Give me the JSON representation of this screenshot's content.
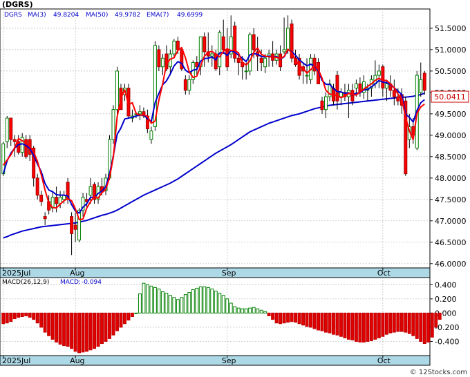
{
  "chart_data": [
    {
      "type": "candlestick",
      "title": "(DGRS)",
      "legend": [
        {
          "name": "DGRS",
          "value": "",
          "color": "#0000cc"
        },
        {
          "name": "MA(3)",
          "value": "49.8204",
          "color": "#0000cc"
        },
        {
          "name": "MA(50)",
          "value": "49.9782",
          "color": "#0000cc"
        },
        {
          "name": "EMA(7)",
          "value": "49.6999",
          "color": "#0000cc"
        }
      ],
      "last_price": "50.0411",
      "x_labels": [
        {
          "label": "2025Jul",
          "index": 0
        },
        {
          "label": "Aug",
          "index": 19
        },
        {
          "label": "Sep",
          "index": 59
        },
        {
          "label": "Oct",
          "index": 100
        }
      ],
      "y_ticks": [
        46.0,
        46.5,
        47.0,
        47.5,
        48.0,
        48.5,
        49.0,
        49.5,
        50.0,
        50.5,
        51.0,
        51.5
      ],
      "ylim": [
        45.9,
        51.95
      ],
      "grid": true,
      "colors": {
        "up": "#008000",
        "down": "#ff0000",
        "ma_short": "#ff0000",
        "ma_long": "#0000cc",
        "price_box": "#cc0000"
      },
      "candles": [
        [
          48.1,
          48.85,
          48.05,
          48.8
        ],
        [
          48.85,
          49.45,
          48.7,
          49.4
        ],
        [
          49.4,
          49.4,
          48.75,
          48.9
        ],
        [
          48.9,
          49.0,
          48.5,
          48.85
        ],
        [
          48.85,
          49.0,
          48.55,
          48.6
        ],
        [
          48.6,
          49.05,
          48.5,
          48.95
        ],
        [
          48.9,
          49.0,
          48.45,
          48.5
        ],
        [
          48.9,
          49.0,
          48.4,
          48.55
        ],
        [
          48.7,
          48.75,
          47.8,
          48.0
        ],
        [
          48.0,
          48.1,
          47.5,
          47.6
        ],
        [
          47.6,
          47.7,
          47.35,
          47.45
        ],
        [
          47.1,
          47.2,
          46.9,
          47.05
        ],
        [
          47.45,
          47.6,
          47.15,
          47.25
        ],
        [
          47.3,
          47.7,
          47.2,
          47.55
        ],
        [
          47.55,
          47.8,
          47.2,
          47.4
        ],
        [
          47.4,
          47.7,
          47.3,
          47.55
        ],
        [
          47.5,
          47.7,
          47.4,
          47.6
        ],
        [
          47.9,
          48.0,
          47.4,
          47.5
        ],
        [
          47.1,
          47.2,
          46.2,
          46.7
        ],
        [
          46.9,
          47.2,
          46.5,
          46.8
        ],
        [
          46.55,
          47.3,
          46.5,
          47.25
        ],
        [
          47.25,
          47.65,
          47.1,
          47.55
        ],
        [
          47.5,
          47.65,
          47.3,
          47.45
        ],
        [
          47.6,
          48.0,
          47.4,
          47.8
        ],
        [
          47.85,
          47.9,
          47.4,
          47.5
        ],
        [
          47.5,
          47.9,
          47.4,
          47.8
        ],
        [
          47.8,
          48.0,
          47.6,
          47.7
        ],
        [
          47.7,
          48.1,
          47.6,
          48.0
        ],
        [
          48.0,
          49.0,
          47.95,
          48.9
        ],
        [
          48.9,
          49.7,
          48.8,
          49.6
        ],
        [
          49.6,
          50.6,
          49.5,
          50.5
        ],
        [
          50.1,
          50.2,
          49.6,
          49.6
        ],
        [
          49.95,
          50.2,
          49.8,
          50.1
        ],
        [
          50.1,
          50.2,
          49.4,
          49.45
        ],
        [
          49.4,
          49.6,
          49.3,
          49.45
        ],
        [
          49.5,
          49.55,
          49.4,
          49.5
        ],
        [
          49.5,
          49.7,
          49.35,
          49.55
        ],
        [
          49.55,
          49.65,
          49.4,
          49.45
        ],
        [
          49.45,
          49.6,
          49.05,
          49.15
        ],
        [
          48.9,
          49.2,
          48.8,
          49.1
        ],
        [
          49.2,
          51.2,
          49.1,
          51.1
        ],
        [
          51.0,
          51.1,
          50.5,
          50.6
        ],
        [
          50.6,
          50.9,
          50.4,
          50.8
        ],
        [
          50.9,
          51.1,
          50.5,
          50.55
        ],
        [
          50.6,
          51.0,
          50.4,
          50.9
        ],
        [
          50.9,
          51.25,
          50.8,
          51.2
        ],
        [
          51.2,
          51.3,
          50.9,
          51.0
        ],
        [
          51.0,
          51.05,
          50.5,
          50.55
        ],
        [
          50.3,
          50.4,
          49.95,
          50.05
        ],
        [
          50.05,
          50.4,
          49.95,
          50.3
        ],
        [
          50.3,
          50.75,
          50.2,
          50.7
        ],
        [
          50.7,
          50.85,
          50.4,
          50.6
        ],
        [
          50.6,
          51.3,
          50.4,
          51.3
        ],
        [
          51.3,
          51.4,
          50.6,
          50.95
        ],
        [
          50.95,
          51.4,
          50.7,
          50.85
        ],
        [
          50.85,
          51.1,
          50.6,
          50.9
        ],
        [
          50.9,
          51.0,
          50.5,
          50.55
        ],
        [
          50.6,
          51.45,
          50.4,
          51.4
        ],
        [
          51.3,
          51.7,
          50.9,
          51.0
        ],
        [
          51.0,
          51.5,
          50.5,
          50.6
        ],
        [
          50.9,
          51.8,
          50.8,
          51.3
        ],
        [
          51.55,
          51.65,
          50.7,
          50.8
        ],
        [
          50.8,
          50.95,
          50.4,
          50.7
        ],
        [
          50.7,
          50.85,
          50.3,
          50.6
        ],
        [
          50.5,
          50.7,
          50.3,
          50.5
        ],
        [
          50.5,
          51.4,
          50.4,
          51.35
        ],
        [
          51.35,
          51.5,
          50.8,
          51.0
        ],
        [
          50.95,
          51.3,
          50.5,
          50.85
        ],
        [
          50.8,
          51.0,
          50.5,
          50.7
        ],
        [
          50.6,
          50.9,
          50.45,
          50.8
        ],
        [
          50.85,
          51.0,
          50.6,
          50.9
        ],
        [
          50.9,
          51.2,
          50.6,
          50.75
        ],
        [
          50.75,
          51.0,
          50.65,
          50.9
        ],
        [
          50.9,
          51.1,
          50.5,
          50.6
        ],
        [
          50.95,
          51.75,
          50.9,
          51.0
        ],
        [
          51.0,
          51.8,
          50.9,
          51.5
        ],
        [
          51.6,
          51.7,
          50.7,
          50.8
        ],
        [
          50.8,
          51.0,
          50.6,
          50.65
        ],
        [
          50.8,
          50.9,
          50.3,
          50.4
        ],
        [
          50.6,
          50.7,
          50.2,
          50.5
        ],
        [
          50.4,
          50.8,
          50.2,
          50.4
        ],
        [
          50.3,
          50.9,
          50.2,
          50.8
        ],
        [
          50.8,
          50.9,
          50.4,
          50.5
        ],
        [
          50.7,
          50.8,
          50.2,
          50.2
        ],
        [
          49.8,
          49.9,
          49.5,
          49.6
        ],
        [
          49.6,
          50.0,
          49.4,
          49.9
        ],
        [
          49.9,
          50.3,
          49.8,
          50.2
        ],
        [
          50.1,
          50.2,
          49.7,
          49.8
        ],
        [
          50.4,
          50.5,
          49.6,
          49.8
        ],
        [
          49.9,
          50.1,
          49.7,
          50.0
        ],
        [
          50.0,
          50.2,
          49.8,
          49.9
        ],
        [
          49.9,
          50.2,
          49.4,
          50.05
        ],
        [
          50.05,
          50.2,
          49.7,
          49.8
        ],
        [
          50.1,
          50.3,
          49.9,
          50.2
        ],
        [
          50.2,
          50.35,
          49.9,
          50.0
        ],
        [
          50.0,
          50.4,
          49.85,
          50.25
        ],
        [
          50.05,
          50.2,
          49.8,
          50.1
        ],
        [
          50.1,
          50.4,
          49.9,
          50.3
        ],
        [
          50.2,
          50.75,
          50.1,
          50.4
        ],
        [
          50.4,
          50.65,
          50.1,
          50.5
        ],
        [
          50.6,
          50.65,
          49.9,
          50.1
        ],
        [
          50.1,
          50.3,
          49.8,
          50.2
        ],
        [
          50.2,
          50.4,
          49.9,
          50.05
        ],
        [
          50.05,
          50.3,
          49.7,
          49.9
        ],
        [
          49.9,
          50.1,
          49.7,
          49.8
        ],
        [
          49.95,
          50.1,
          49.5,
          49.7
        ],
        [
          49.8,
          49.9,
          48.05,
          48.1
        ],
        [
          48.9,
          49.5,
          48.7,
          49.2
        ],
        [
          49.2,
          49.4,
          48.8,
          49.0
        ],
        [
          48.7,
          50.5,
          48.65,
          50.4
        ],
        [
          50.0,
          50.7,
          49.9,
          50.3
        ],
        [
          50.45,
          50.5,
          49.95,
          50.05
        ]
      ],
      "series": [
        {
          "name": "MA(3)",
          "values": [
            48.3,
            48.42,
            48.54,
            48.71,
            48.92,
            48.87,
            48.82,
            48.74,
            48.61,
            48.39,
            48.08,
            47.72,
            47.42,
            47.31,
            47.3,
            47.39,
            47.47,
            47.52,
            47.47,
            47.28,
            47.03,
            47.04,
            47.3,
            47.45,
            47.57,
            47.53,
            47.66,
            47.73,
            48.01,
            48.49,
            49.43,
            49.87,
            50.06,
            49.71,
            49.76,
            49.51,
            49.47,
            49.48,
            49.44,
            49.28,
            49.33,
            49.82,
            50.2,
            50.66,
            50.78,
            50.81,
            50.98,
            51.05,
            50.81,
            50.48,
            50.35,
            50.38,
            50.62,
            50.85,
            50.94,
            50.96,
            50.89,
            50.83,
            50.96,
            51.02,
            50.98,
            50.99,
            50.92,
            50.7,
            50.64,
            50.74,
            50.94,
            51.04,
            50.89,
            50.85,
            50.83,
            50.83,
            50.82,
            50.79,
            50.84,
            51.01,
            50.93,
            50.76,
            50.62,
            50.57,
            50.45,
            50.53,
            50.64,
            50.54,
            50.33,
            50.05,
            49.96,
            49.95,
            49.92,
            49.88,
            49.91,
            49.98,
            49.95,
            49.94,
            50.01,
            50.08,
            50.14,
            50.2,
            50.28,
            50.33,
            50.28,
            50.28,
            50.2,
            50.11,
            49.96,
            49.85,
            49.42,
            49.1,
            48.9,
            49.51,
            49.66,
            49.73
          ]
        },
        {
          "name": "MA(50)",
          "values": [
            46.6,
            46.63,
            46.67,
            46.7,
            46.73,
            46.76,
            46.78,
            46.8,
            46.82,
            46.84,
            46.86,
            46.87,
            46.88,
            46.89,
            46.9,
            46.91,
            46.92,
            46.93,
            46.94,
            46.95,
            46.97,
            46.99,
            47.01,
            47.04,
            47.07,
            47.1,
            47.13,
            47.15,
            47.18,
            47.21,
            47.25,
            47.3,
            47.35,
            47.4,
            47.45,
            47.5,
            47.55,
            47.6,
            47.64,
            47.68,
            47.72,
            47.76,
            47.8,
            47.84,
            47.88,
            47.93,
            47.98,
            48.04,
            48.1,
            48.16,
            48.22,
            48.28,
            48.34,
            48.4,
            48.46,
            48.52,
            48.58,
            48.63,
            48.68,
            48.73,
            48.78,
            48.84,
            48.9,
            48.96,
            49.02,
            49.08,
            49.12,
            49.16,
            49.2,
            49.24,
            49.28,
            49.31,
            49.34,
            49.37,
            49.4,
            49.43,
            49.46,
            49.48,
            49.5,
            49.53,
            49.56,
            49.59,
            49.62,
            49.64,
            49.66,
            49.68,
            49.7,
            49.71,
            49.72,
            49.73,
            49.74,
            49.75,
            49.76,
            49.77,
            49.78,
            49.79,
            49.8,
            49.81,
            49.82,
            49.83,
            49.84,
            49.85,
            49.86,
            49.87,
            49.88,
            49.89,
            49.89,
            49.9,
            49.91,
            49.93,
            49.95,
            49.98
          ]
        },
        {
          "name": "EMA(7)",
          "values": [
            48.1,
            48.4,
            48.58,
            48.7,
            48.78,
            48.8,
            48.76,
            48.69,
            48.53,
            48.33,
            48.15,
            47.87,
            47.72,
            47.68,
            47.61,
            47.6,
            47.6,
            47.58,
            47.38,
            47.23,
            47.18,
            47.32,
            47.4,
            47.55,
            47.55,
            47.64,
            47.69,
            47.8,
            48.1,
            48.52,
            49.02,
            49.17,
            49.38,
            49.4,
            49.42,
            49.45,
            49.47,
            49.47,
            49.39,
            49.32,
            49.76,
            49.98,
            50.18,
            50.27,
            50.43,
            50.62,
            50.72,
            50.68,
            50.52,
            50.46,
            50.52,
            50.54,
            50.73,
            50.79,
            50.8,
            50.83,
            50.76,
            50.92,
            50.94,
            50.86,
            50.98,
            50.94,
            50.87,
            50.8,
            50.72,
            50.88,
            50.91,
            50.89,
            50.84,
            50.83,
            50.85,
            50.83,
            50.84,
            50.78,
            50.83,
            51.0,
            50.95,
            50.87,
            50.76,
            50.69,
            50.62,
            50.66,
            50.62,
            50.51,
            50.28,
            50.19,
            50.19,
            50.09,
            50.02,
            50.01,
            49.98,
            49.99,
            49.94,
            49.98,
            49.99,
            50.06,
            50.07,
            50.13,
            50.2,
            50.28,
            50.24,
            50.23,
            50.18,
            50.11,
            50.03,
            49.95,
            49.49,
            49.42,
            49.31,
            49.58,
            49.76,
            49.83
          ]
        }
      ]
    },
    {
      "type": "bar",
      "title": "MACD(26,12,9)",
      "label": "MACD:",
      "value_label": "-0.094",
      "y_ticks": [
        "0.400",
        "0.200",
        "0.000",
        "-0.200",
        "-0.400"
      ],
      "ylim": [
        -0.6,
        0.5
      ],
      "x_labels": [
        {
          "label": "2025Jul",
          "index": 0
        },
        {
          "label": "Aug",
          "index": 19
        },
        {
          "label": "Sep",
          "index": 59
        },
        {
          "label": "Oct",
          "index": 100
        }
      ],
      "values": [
        -0.15,
        -0.14,
        -0.12,
        -0.08,
        -0.06,
        -0.05,
        -0.04,
        -0.06,
        -0.09,
        -0.14,
        -0.2,
        -0.27,
        -0.32,
        -0.37,
        -0.41,
        -0.44,
        -0.46,
        -0.47,
        -0.5,
        -0.54,
        -0.56,
        -0.55,
        -0.54,
        -0.52,
        -0.5,
        -0.47,
        -0.43,
        -0.4,
        -0.36,
        -0.31,
        -0.25,
        -0.2,
        -0.15,
        -0.1,
        -0.05,
        0.0,
        0.27,
        0.42,
        0.4,
        0.38,
        0.36,
        0.34,
        0.3,
        0.28,
        0.25,
        0.22,
        0.19,
        0.22,
        0.26,
        0.29,
        0.33,
        0.35,
        0.37,
        0.37,
        0.36,
        0.34,
        0.31,
        0.28,
        0.25,
        0.2,
        0.14,
        0.09,
        0.07,
        0.06,
        0.06,
        0.07,
        0.08,
        0.06,
        0.04,
        0.02,
        -0.04,
        -0.09,
        -0.14,
        -0.15,
        -0.14,
        -0.13,
        -0.12,
        -0.13,
        -0.15,
        -0.17,
        -0.19,
        -0.2,
        -0.22,
        -0.24,
        -0.25,
        -0.27,
        -0.28,
        -0.3,
        -0.31,
        -0.33,
        -0.35,
        -0.37,
        -0.38,
        -0.4,
        -0.41,
        -0.41,
        -0.4,
        -0.39,
        -0.37,
        -0.35,
        -0.33,
        -0.3,
        -0.28,
        -0.27,
        -0.26,
        -0.26,
        -0.27,
        -0.29,
        -0.32,
        -0.36,
        -0.4,
        -0.43,
        -0.41,
        -0.34,
        -0.2,
        -0.09
      ]
    }
  ],
  "watermark": "© 12Stocks.com"
}
